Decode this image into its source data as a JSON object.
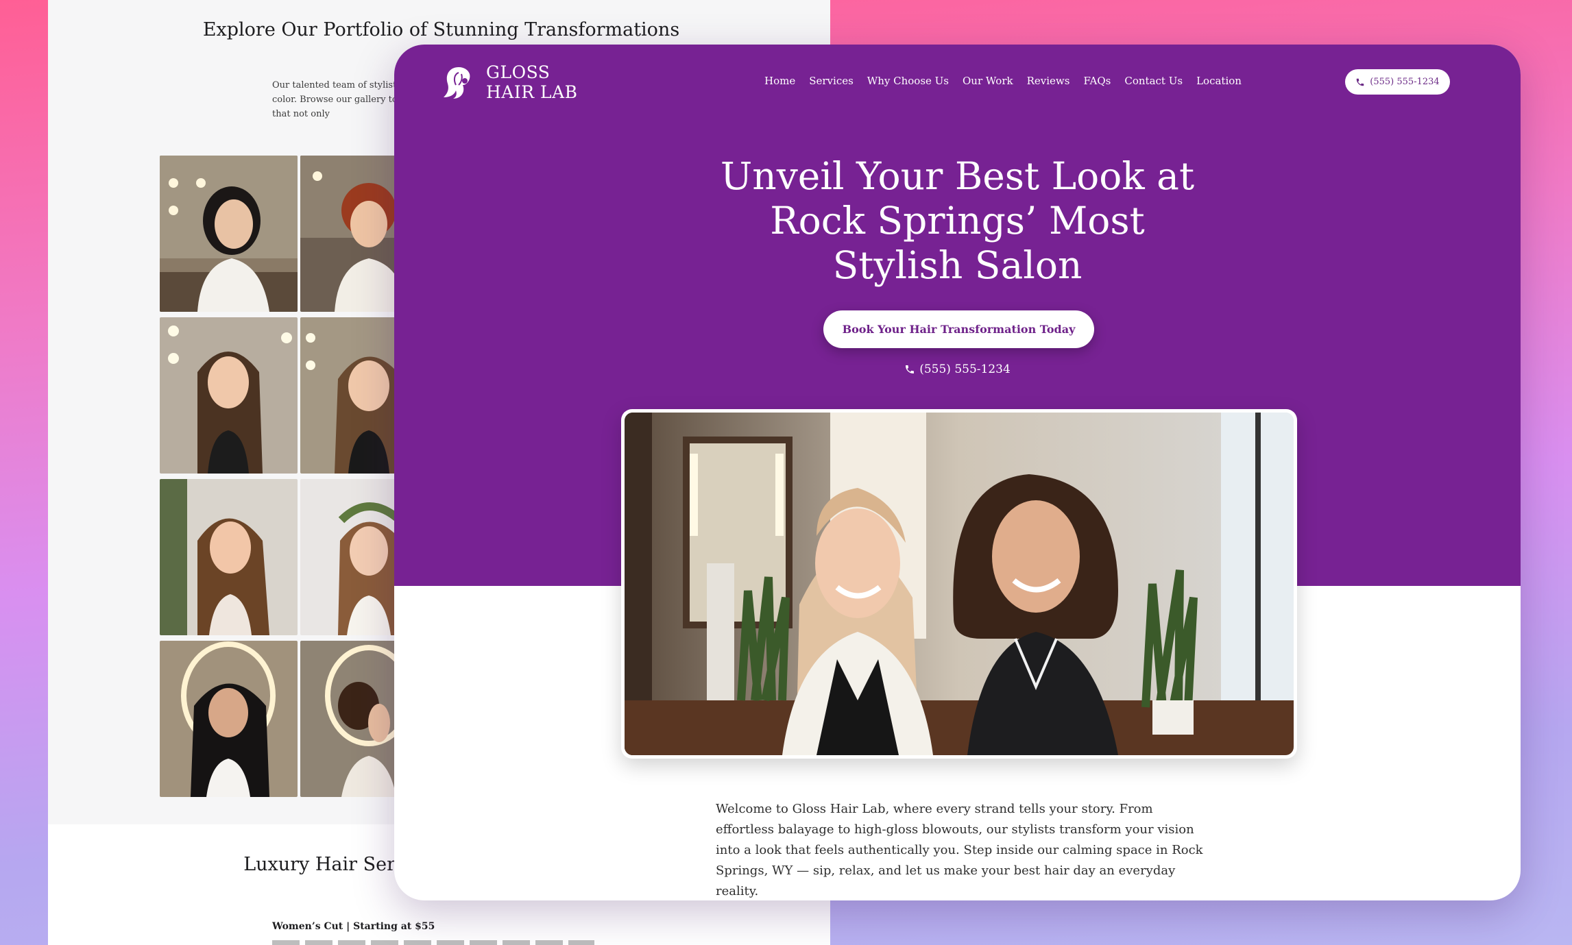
{
  "back_page": {
    "title": "Explore Our Portfolio of Stunning Transformations",
    "intro": "Our talented team of stylists create precision cuts and beautiful, lived-in color. Browse our gallery to see the artistry in action — transformations that not only",
    "gallery": [
      {
        "alt": "Woman with sleek black bob"
      },
      {
        "alt": "Woman with short red curly hair"
      },
      {
        "alt": "Woman with long straight brown hair"
      },
      {
        "alt": "Woman with wavy brown hair"
      },
      {
        "alt": "Woman with soft brown waves"
      },
      {
        "alt": "Bride with flower crown"
      },
      {
        "alt": "Woman with voluminous black waves"
      },
      {
        "alt": "Woman with elegant updo"
      }
    ],
    "section_title": "Luxury Hair Services for Every Luxe Look",
    "service_line": "Women’s Cut | Starting at $55"
  },
  "front": {
    "logo": {
      "line1": "GLOSS",
      "line2": "HAIR LAB",
      "icon": "hair-silhouette-icon"
    },
    "nav": [
      "Home",
      "Services",
      "Why Choose Us",
      "Our Work",
      "Reviews",
      "FAQs",
      "Contact Us",
      "Location"
    ],
    "header_phone": "(555) 555-1234",
    "hero": {
      "title_line1": "Unveil Your Best Look at",
      "title_line2": "Rock Springs’ Most",
      "title_line3": "Stylish Salon",
      "cta": "Book Your Hair Transformation Today",
      "phone": "(555) 555-1234",
      "photo_alt": "Two smiling stylists in a salon"
    },
    "welcome": "Welcome to Gloss Hair Lab, where every strand tells your story. From effortless balayage to high-gloss blowouts, our stylists transform your vision into a look that feels authentically you. Step inside our calming space in Rock Springs, WY — sip, relax, and let us make your best hair day an everyday reality."
  },
  "colors": {
    "brand_purple": "#772293",
    "page_bg_top": "#ff5f95",
    "page_bg_bottom": "#b9b6f2"
  }
}
